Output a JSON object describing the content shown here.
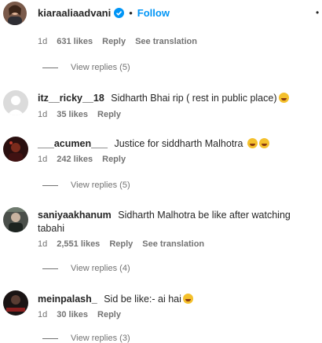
{
  "header": {
    "username": "kiaraaliaadvani",
    "dot": "•",
    "follow_label": "Follow",
    "more": "•"
  },
  "top_meta": {
    "age": "1d",
    "likes": "631 likes",
    "reply": "Reply",
    "translate": "See translation"
  },
  "top_view_replies": "View replies (5)",
  "comments": [
    {
      "username": "itz__ricky__18",
      "text": "Sidharth Bhai rip ( rest in public place)",
      "emojis": [
        "face-emoji"
      ],
      "age": "1d",
      "likes": "35 likes",
      "reply": "Reply"
    },
    {
      "username": "___acumen___",
      "text": "Justice for siddharth Malhotra",
      "emojis": [
        "laughing-emoji",
        "laughing-emoji"
      ],
      "age": "1d",
      "likes": "242 likes",
      "reply": "Reply",
      "view_replies": "View replies (5)"
    },
    {
      "username": "saniyaakhanum",
      "text": "Sidharth Malhotra be like after watching",
      "text2": "tabahi",
      "age": "1d",
      "likes": "2,551 likes",
      "reply": "Reply",
      "translate": "See translation",
      "view_replies": "View replies (4)"
    },
    {
      "username": "meinpalash_",
      "text": "Sid be like:- ai hai",
      "emojis": [
        "face-emoji"
      ],
      "age": "1d",
      "likes": "30 likes",
      "reply": "Reply"
    }
  ],
  "bottom_partial": "View replies (3)",
  "colors": {
    "link_blue": "#0095f6",
    "verified_blue": "#0095f6",
    "secondary": "#737373"
  }
}
